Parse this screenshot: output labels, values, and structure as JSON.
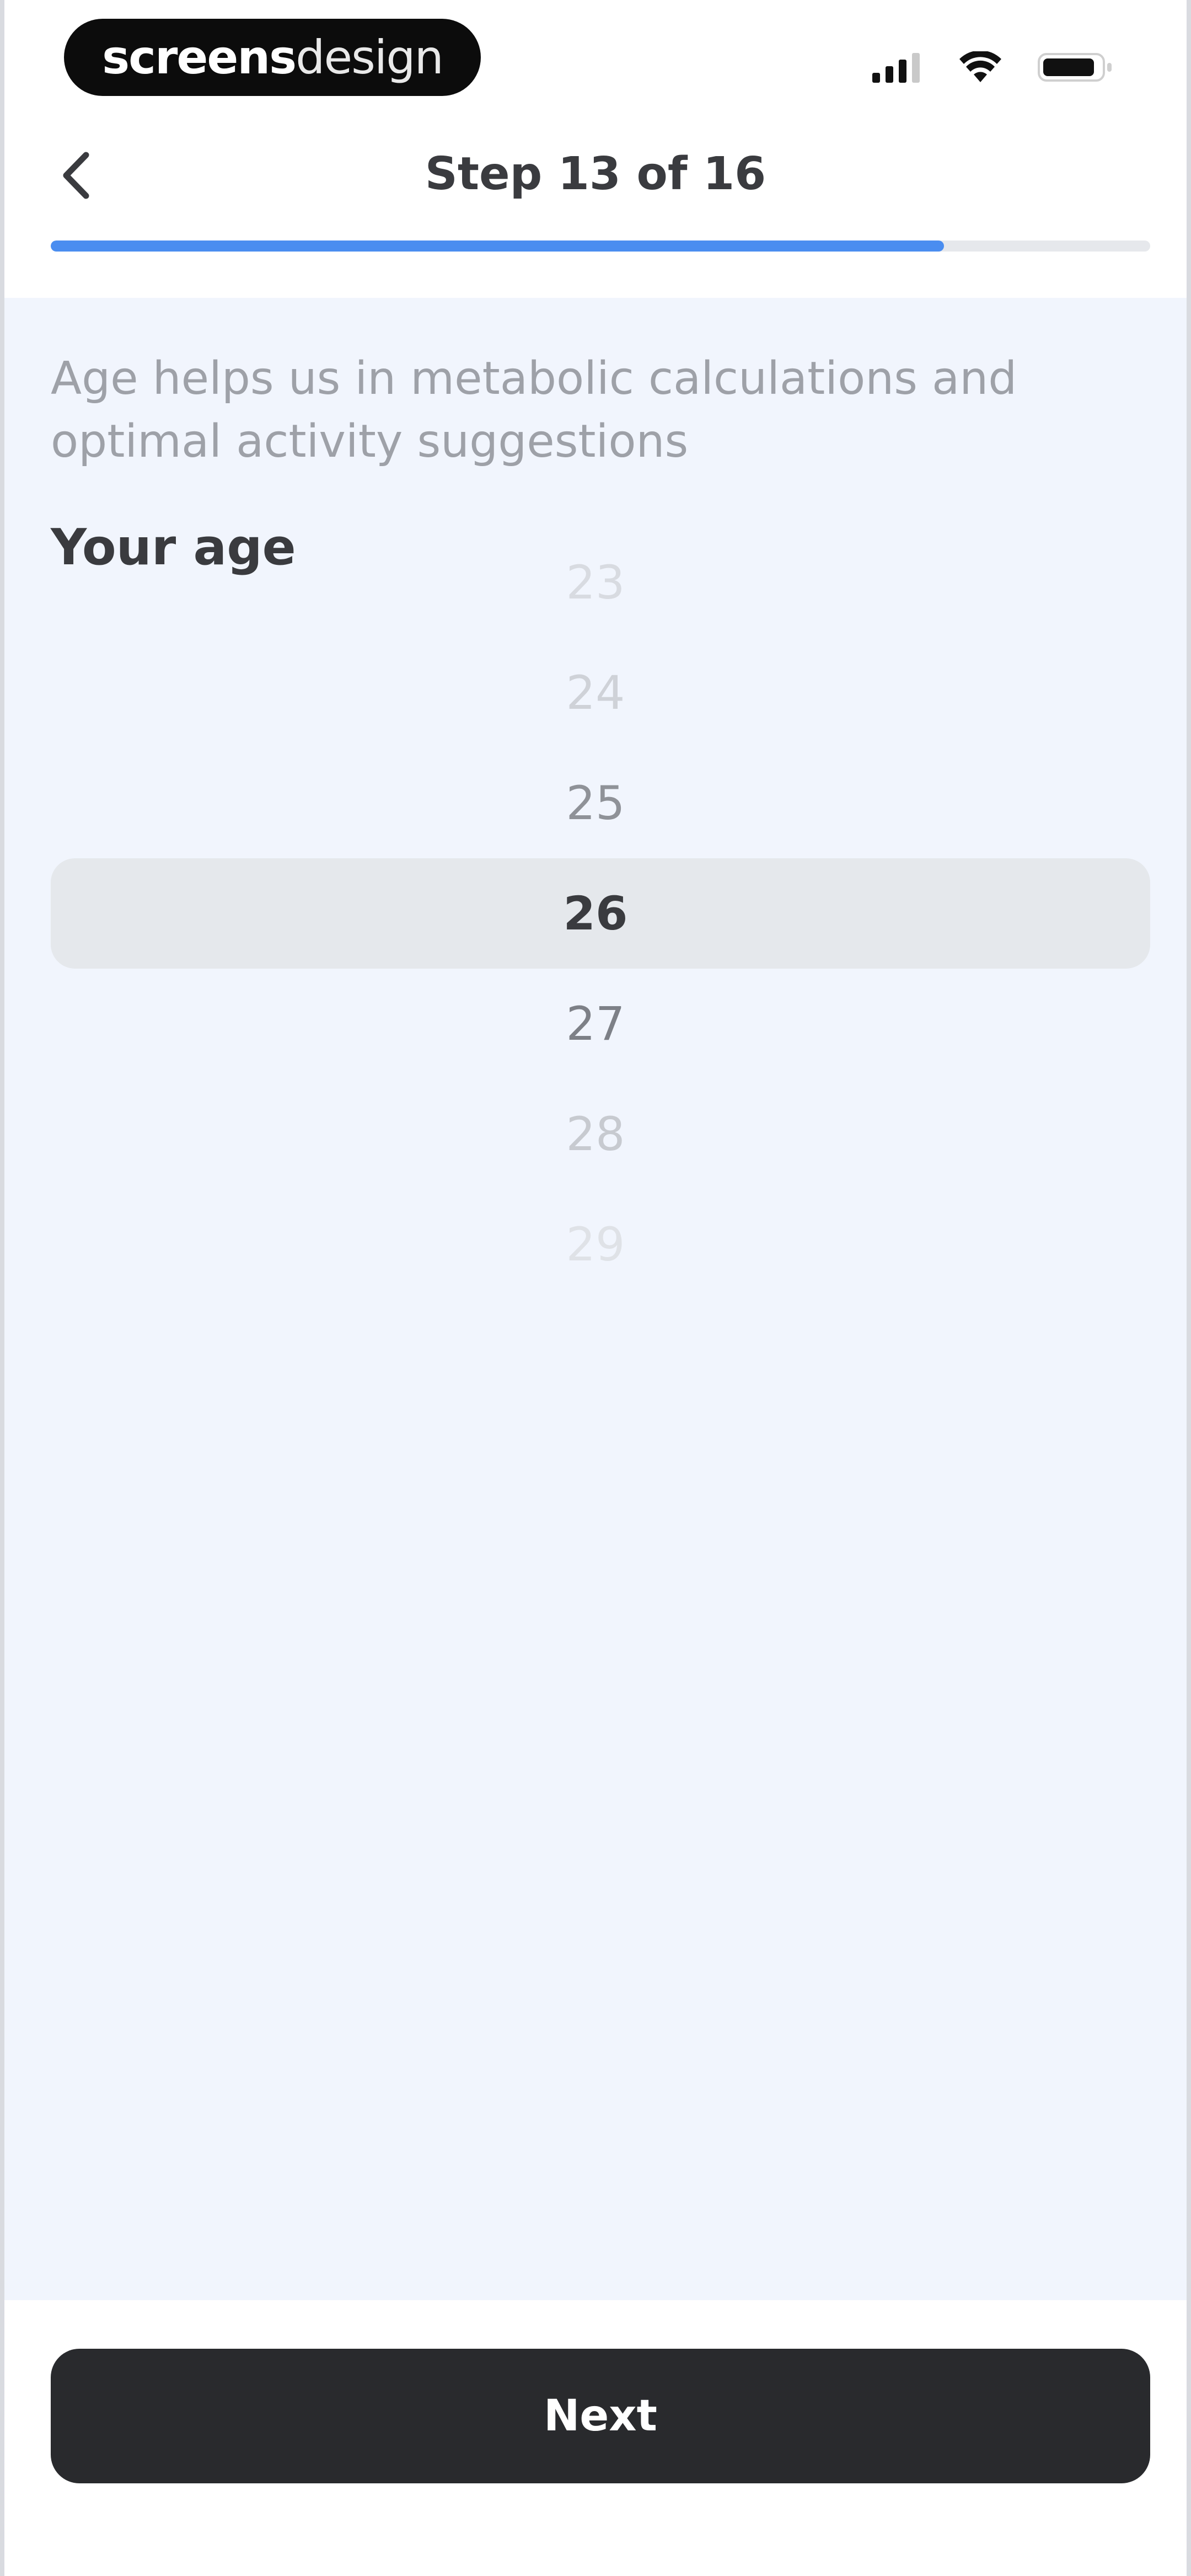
{
  "status_bar": {
    "brand_bold": "screens",
    "brand_light": "design",
    "icons": [
      "signal-icon",
      "wifi-icon",
      "battery-icon"
    ]
  },
  "header": {
    "back_icon": "chevron-left-icon",
    "title": "Step 13 of 16",
    "progress": {
      "current": 13,
      "total": 16,
      "fraction": 0.8125
    },
    "accent_color": "#4a8df0"
  },
  "content": {
    "subtitle": "Age helps us in metabolic calculations and optimal activity suggestions",
    "question": "Your age"
  },
  "picker": {
    "selected": "26",
    "items": [
      {
        "value": "23",
        "color": "#d8dbe1"
      },
      {
        "value": "24",
        "color": "#cfd2d8"
      },
      {
        "value": "25",
        "color": "#8f9298"
      },
      {
        "value": "26",
        "color": "#3a3b3f"
      },
      {
        "value": "27",
        "color": "#7d8087"
      },
      {
        "value": "28",
        "color": "#c7cad0"
      },
      {
        "value": "29",
        "color": "#dfe2e7"
      }
    ]
  },
  "footer": {
    "next_label": "Next",
    "button_color": "#292a2d"
  }
}
